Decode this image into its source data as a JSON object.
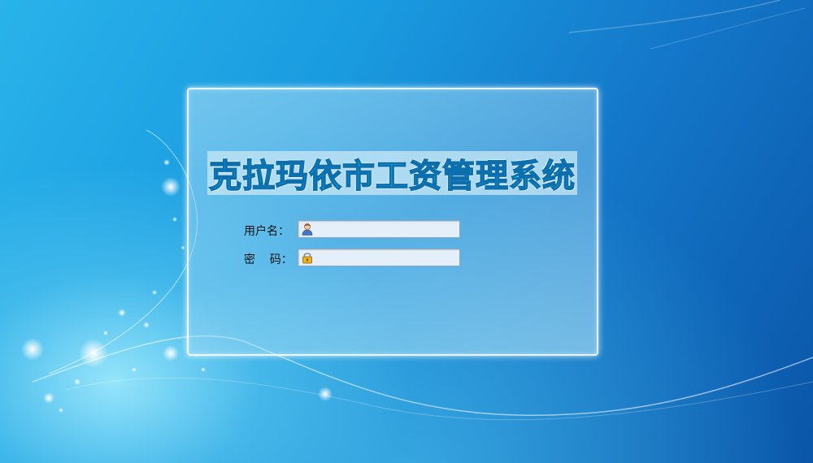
{
  "app": {
    "title": "克拉玛依市工资管理系统"
  },
  "login_form": {
    "username_label": "用户名：",
    "username_value": "",
    "username_icon": "user-icon",
    "password_label": "密    码：",
    "password_value": "",
    "password_icon": "lock-icon"
  },
  "colors": {
    "background_primary": "#1a9be0",
    "background_dark": "#0a55a8",
    "title_fill": "#2cc6f4",
    "title_outline": "#0b6fae",
    "field_bg": "#e4effa"
  }
}
